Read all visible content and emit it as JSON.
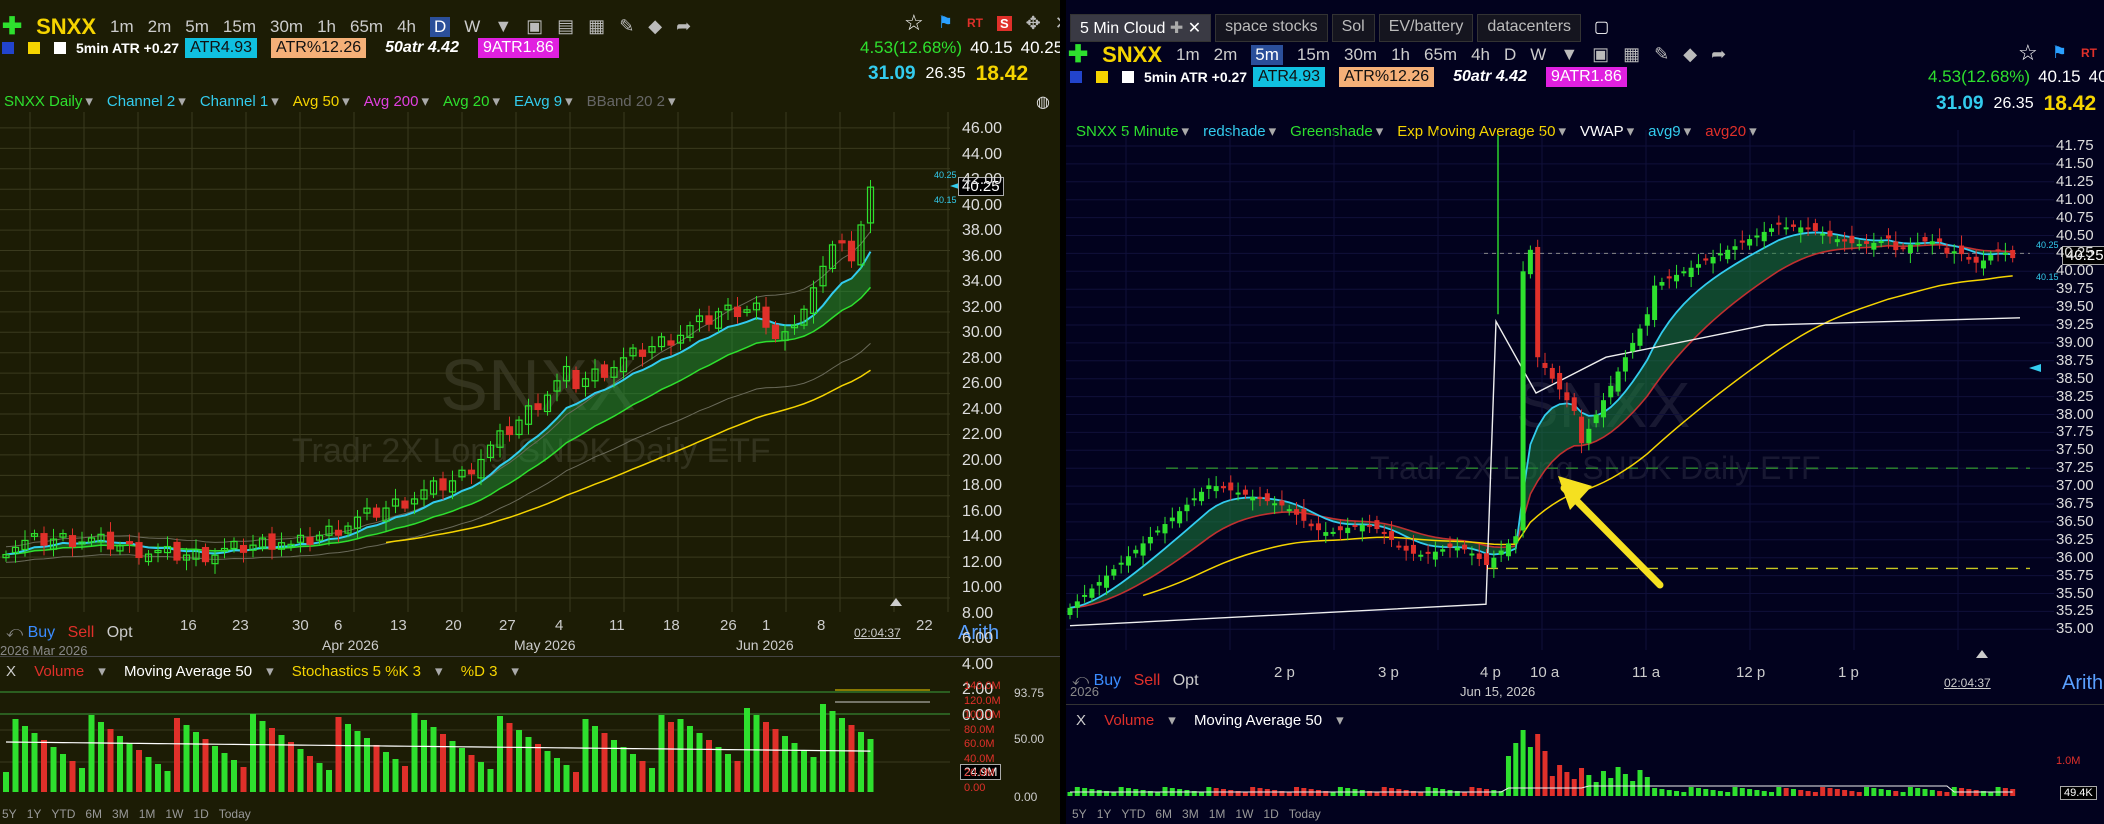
{
  "left": {
    "toolbar": {
      "symbol": "SNXX",
      "timeframes": [
        "1m",
        "2m",
        "5m",
        "15m",
        "30m",
        "1h",
        "65m",
        "4h",
        "D",
        "W"
      ],
      "active_tf": "D"
    },
    "indicators": {
      "atr5": "5min ATR +0.27",
      "atr": "ATR4.93",
      "atrpct": "ATR%12.26",
      "atr50": "50atr 4.42",
      "atr9": "9ATR1.86"
    },
    "quote": {
      "change": "4.53(12.68%)",
      "bid": "40.15",
      "ask": "40.25",
      "v1": "31.09",
      "v2": "26.35",
      "v3": "18.42"
    },
    "legend": [
      {
        "label": "SNXX Daily",
        "color": "#2ee02e"
      },
      {
        "label": "Channel 2",
        "color": "#33ccee"
      },
      {
        "label": "Channel 1",
        "color": "#33ccee"
      },
      {
        "label": "Avg 50",
        "color": "#f5d400"
      },
      {
        "label": "Avg 200",
        "color": "#e040e0"
      },
      {
        "label": "Avg 20",
        "color": "#2ee02e"
      },
      {
        "label": "EAvg 9",
        "color": "#33ccee"
      },
      {
        "label": "BBand 20 2",
        "color": "#666"
      }
    ],
    "yaxis": [
      "46.00",
      "44.00",
      "42.00",
      "40.00",
      "38.00",
      "36.00",
      "34.00",
      "32.00",
      "30.00",
      "28.00",
      "26.00",
      "24.00",
      "22.00",
      "20.00",
      "18.00",
      "16.00",
      "14.00",
      "12.00",
      "10.00",
      "8.00",
      "6.00",
      "4.00",
      "2.00",
      "0.00"
    ],
    "price_box": "40.25",
    "price_small_top": "40.25",
    "price_small_bot": "40.15",
    "xaxis_days": [
      "16",
      "23",
      "30",
      "6",
      "13",
      "20",
      "27",
      "4",
      "11",
      "18",
      "26",
      "1",
      "8",
      "22"
    ],
    "xaxis_months": [
      "Apr 2026",
      "May 2026",
      "Jun 2026"
    ],
    "xaxis_left_cut": "2026 Mar 2026",
    "time": "02:04:37",
    "scale": "Arith",
    "buy": "Buy",
    "sell": "Sell",
    "opt": "Opt",
    "watermark_symbol": "SNXX",
    "watermark_name": "Tradr 2X Long SNDK Daily ETF",
    "vol_legend": {
      "x": "X",
      "volume": "Volume",
      "ma": "Moving Average 50",
      "stoch": "Stochastics 5 %K 3",
      "pd": "%D 3"
    },
    "vol_axis": [
      "140.0M",
      "120.0M",
      "100.0M",
      "80.0M",
      "60.0M",
      "40.0M",
      "20.0M",
      "0.00"
    ],
    "stoch_axis": [
      "93.75",
      "50.00",
      "0.00"
    ],
    "vol_box": "24.9M",
    "ranges": [
      "5Y",
      "1Y",
      "YTD",
      "6M",
      "3M",
      "1M",
      "1W",
      "1D",
      "Today"
    ]
  },
  "right": {
    "tabs": [
      "5 Min Cloud",
      "space stocks",
      "Sol",
      "EV/battery",
      "datacenters"
    ],
    "toolbar": {
      "symbol": "SNXX",
      "timeframes": [
        "1m",
        "2m",
        "5m",
        "15m",
        "30m",
        "1h",
        "65m",
        "4h",
        "D",
        "W"
      ],
      "active_tf": "5m"
    },
    "indicators": {
      "atr5": "5min ATR +0.27",
      "atr": "ATR4.93",
      "atrpct": "ATR%12.26",
      "atr50": "50atr 4.42",
      "atr9": "9ATR1.86"
    },
    "quote": {
      "change": "4.53(12.68%)",
      "bid": "40.15",
      "ask": "40",
      "v1": "31.09",
      "v2": "26.35",
      "v3": "18.42"
    },
    "legend": [
      {
        "label": "SNXX 5 Minute",
        "color": "#2ee02e"
      },
      {
        "label": "redshade",
        "color": "#33ccee"
      },
      {
        "label": "Greenshade",
        "color": "#2ee02e"
      },
      {
        "label": "Exp Moving Average 50",
        "color": "#f5d400"
      },
      {
        "label": "VWAP",
        "color": "#fff"
      },
      {
        "label": "avg9",
        "color": "#33ccee"
      },
      {
        "label": "avg20",
        "color": "#e0302a"
      }
    ],
    "yaxis": [
      "41.75",
      "41.50",
      "41.25",
      "41.00",
      "40.75",
      "40.50",
      "40.25",
      "40.00",
      "39.75",
      "39.50",
      "39.25",
      "39.00",
      "38.75",
      "38.50",
      "38.25",
      "38.00",
      "37.75",
      "37.50",
      "37.25",
      "37.00",
      "36.75",
      "36.50",
      "36.25",
      "36.00",
      "35.75",
      "35.50",
      "35.25",
      "35.00"
    ],
    "price_box": "40.25",
    "price_small_top": "40.25",
    "price_small_bot": "40.15",
    "xaxis": [
      "2 p",
      "3 p",
      "4 p",
      "10 a",
      "11 a",
      "12 p",
      "1 p"
    ],
    "date": "Jun 15, 2026",
    "xaxis_left_cut": "2026",
    "time": "02:04:37",
    "buy": "Buy",
    "sell": "Sell",
    "opt": "Opt",
    "watermark_symbol": "SNXX",
    "watermark_name": "Tradr 2X Long SNDK Daily ETF",
    "vol_legend": {
      "x": "X",
      "volume": "Volume",
      "ma": "Moving Average 50"
    },
    "vol_axis": [
      "1.0M"
    ],
    "vol_box": "49.4K",
    "ranges": [
      "5Y",
      "1Y",
      "YTD",
      "6M",
      "3M",
      "1M",
      "1W",
      "1D",
      "Today"
    ]
  }
}
